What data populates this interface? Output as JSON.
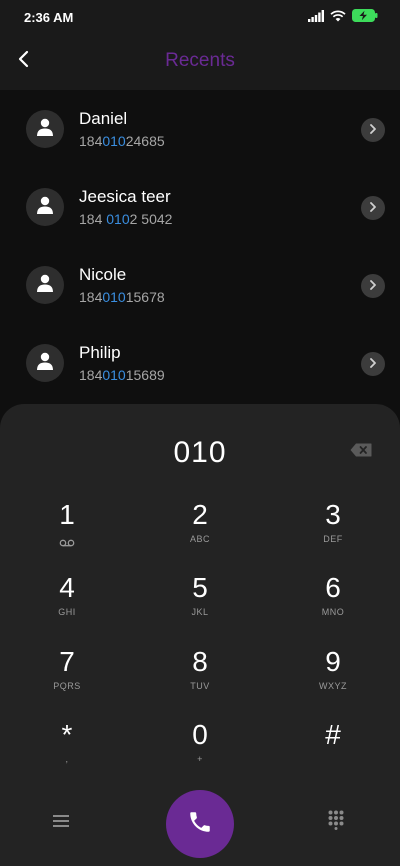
{
  "status_bar": {
    "time": "2:36 AM",
    "icons": [
      "signal-icon",
      "wifi-icon",
      "battery-charging-icon"
    ]
  },
  "header": {
    "title": "Recents",
    "title_color": "#6a2a94"
  },
  "contacts": [
    {
      "name": "Daniel",
      "number_pre": "184",
      "number_match": "010",
      "number_post": "24685"
    },
    {
      "name": "Jeesica teer",
      "number_pre": "184 ",
      "number_match": "010",
      "number_post": "2 5042"
    },
    {
      "name": "Nicole",
      "number_pre": "184",
      "number_match": "010",
      "number_post": "15678"
    },
    {
      "name": "Philip",
      "number_pre": "184",
      "number_match": "010",
      "number_post": "15689"
    }
  ],
  "dialpad": {
    "input_value": "010",
    "keys": [
      {
        "digit": "1",
        "sub": ""
      },
      {
        "digit": "2",
        "sub": "ABC"
      },
      {
        "digit": "3",
        "sub": "DEF"
      },
      {
        "digit": "4",
        "sub": "GHI"
      },
      {
        "digit": "5",
        "sub": "JKL"
      },
      {
        "digit": "6",
        "sub": "MNO"
      },
      {
        "digit": "7",
        "sub": "PQRS"
      },
      {
        "digit": "8",
        "sub": "TUV"
      },
      {
        "digit": "9",
        "sub": "WXYZ"
      },
      {
        "digit": "*",
        "sub": ","
      },
      {
        "digit": "0",
        "sub": "+"
      },
      {
        "digit": "#",
        "sub": ""
      }
    ]
  },
  "colors": {
    "accent": "#6a2a94",
    "match_highlight": "#3a8ee0"
  }
}
